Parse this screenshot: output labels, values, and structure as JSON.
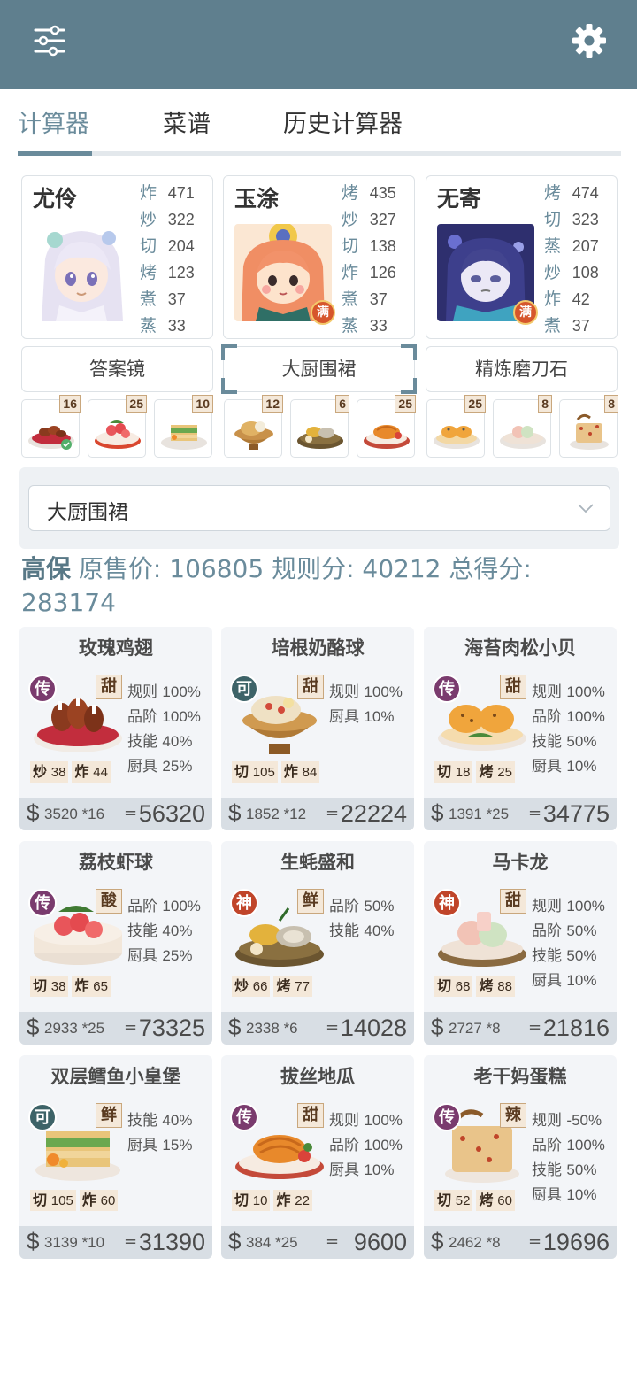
{
  "header": {
    "menu_icon": "sliders-icon",
    "settings_icon": "gear-icon",
    "bar_color": "#5f7f8e"
  },
  "tabs": [
    {
      "label": "计算器",
      "active": true
    },
    {
      "label": "菜谱",
      "active": false
    },
    {
      "label": "历史计算器",
      "active": false
    }
  ],
  "chefs": [
    {
      "name": "尤伶",
      "full": false,
      "skills": [
        {
          "k": "炸",
          "v": "471"
        },
        {
          "k": "炒",
          "v": "322"
        },
        {
          "k": "切",
          "v": "204"
        },
        {
          "k": "烤",
          "v": "123"
        },
        {
          "k": "煮",
          "v": "37"
        },
        {
          "k": "蒸",
          "v": "33"
        }
      ]
    },
    {
      "name": "玉涂",
      "full": true,
      "full_label": "满",
      "skills": [
        {
          "k": "烤",
          "v": "435"
        },
        {
          "k": "炒",
          "v": "327"
        },
        {
          "k": "切",
          "v": "138"
        },
        {
          "k": "炸",
          "v": "126"
        },
        {
          "k": "煮",
          "v": "37"
        },
        {
          "k": "蒸",
          "v": "33"
        }
      ]
    },
    {
      "name": "无寄",
      "full": true,
      "full_label": "满",
      "skills": [
        {
          "k": "烤",
          "v": "474"
        },
        {
          "k": "切",
          "v": "323"
        },
        {
          "k": "蒸",
          "v": "207"
        },
        {
          "k": "炒",
          "v": "108"
        },
        {
          "k": "炸",
          "v": "42"
        },
        {
          "k": "煮",
          "v": "37"
        }
      ]
    }
  ],
  "equipment_buttons": [
    {
      "label": "答案镜",
      "selected": false
    },
    {
      "label": "大厨围裙",
      "selected": true
    },
    {
      "label": "精炼磨刀石",
      "selected": false
    }
  ],
  "mini_dishes": [
    {
      "count": "16"
    },
    {
      "count": "25"
    },
    {
      "count": "10"
    },
    {
      "count": "12"
    },
    {
      "count": "6"
    },
    {
      "count": "25"
    },
    {
      "count": "25"
    },
    {
      "count": "8"
    },
    {
      "count": "8"
    }
  ],
  "equip_select": {
    "value": "大厨围裙"
  },
  "summary": {
    "grade": "高保",
    "orig_label": "原售价:",
    "orig_value": "106805",
    "rule_label": "规则分:",
    "rule_value": "40212",
    "total_label": "总得分:",
    "total_value": "283174"
  },
  "dishes": [
    {
      "name": "玫瑰鸡翅",
      "rarity": "传",
      "rarity_color": "#7a3b6e",
      "flavor": "甜",
      "bonus": [
        {
          "k": "规则",
          "v": "100%"
        },
        {
          "k": "品阶",
          "v": "100%"
        },
        {
          "k": "技能",
          "v": "40%"
        },
        {
          "k": "厨具",
          "v": "25%"
        }
      ],
      "req": [
        {
          "k": "炒",
          "v": "38"
        },
        {
          "k": "炸",
          "v": "44"
        }
      ],
      "price": "3520",
      "qty": "*16",
      "total": "56320"
    },
    {
      "name": "培根奶酪球",
      "rarity": "可",
      "rarity_color": "#3d6368",
      "flavor": "甜",
      "bonus": [
        {
          "k": "规则",
          "v": "100%"
        },
        {
          "k": "厨具",
          "v": "10%"
        }
      ],
      "req": [
        {
          "k": "切",
          "v": "105"
        },
        {
          "k": "炸",
          "v": "84"
        }
      ],
      "price": "1852",
      "qty": "*12",
      "total": "22224"
    },
    {
      "name": "海苔肉松小贝",
      "rarity": "传",
      "rarity_color": "#7a3b6e",
      "flavor": "甜",
      "bonus": [
        {
          "k": "规则",
          "v": "100%"
        },
        {
          "k": "品阶",
          "v": "100%"
        },
        {
          "k": "技能",
          "v": "50%"
        },
        {
          "k": "厨具",
          "v": "10%"
        }
      ],
      "req": [
        {
          "k": "切",
          "v": "18"
        },
        {
          "k": "烤",
          "v": "25"
        }
      ],
      "price": "1391",
      "qty": "*25",
      "total": "34775"
    },
    {
      "name": "荔枝虾球",
      "rarity": "传",
      "rarity_color": "#7a3b6e",
      "flavor": "酸",
      "bonus": [
        {
          "k": "品阶",
          "v": "100%"
        },
        {
          "k": "技能",
          "v": "40%"
        },
        {
          "k": "厨具",
          "v": "25%"
        }
      ],
      "req": [
        {
          "k": "切",
          "v": "38"
        },
        {
          "k": "炸",
          "v": "65"
        }
      ],
      "price": "2933",
      "qty": "*25",
      "total": "73325"
    },
    {
      "name": "生蚝盛和",
      "rarity": "神",
      "rarity_color": "#c0452a",
      "flavor": "鲜",
      "bonus": [
        {
          "k": "品阶",
          "v": "50%"
        },
        {
          "k": "技能",
          "v": "40%"
        }
      ],
      "req": [
        {
          "k": "炒",
          "v": "66"
        },
        {
          "k": "烤",
          "v": "77"
        }
      ],
      "price": "2338",
      "qty": "*6",
      "total": "14028"
    },
    {
      "name": "马卡龙",
      "rarity": "神",
      "rarity_color": "#c0452a",
      "flavor": "甜",
      "bonus": [
        {
          "k": "规则",
          "v": "100%"
        },
        {
          "k": "品阶",
          "v": "50%"
        },
        {
          "k": "技能",
          "v": "50%"
        },
        {
          "k": "厨具",
          "v": "10%"
        }
      ],
      "req": [
        {
          "k": "切",
          "v": "68"
        },
        {
          "k": "烤",
          "v": "88"
        }
      ],
      "price": "2727",
      "qty": "*8",
      "total": "21816"
    },
    {
      "name": "双层鳕鱼小皇堡",
      "rarity": "可",
      "rarity_color": "#3d6368",
      "flavor": "鲜",
      "bonus": [
        {
          "k": "技能",
          "v": "40%"
        },
        {
          "k": "厨具",
          "v": "15%"
        }
      ],
      "req": [
        {
          "k": "切",
          "v": "105"
        },
        {
          "k": "炸",
          "v": "60"
        }
      ],
      "price": "3139",
      "qty": "*10",
      "total": "31390"
    },
    {
      "name": "拔丝地瓜",
      "rarity": "传",
      "rarity_color": "#7a3b6e",
      "flavor": "甜",
      "bonus": [
        {
          "k": "规则",
          "v": "100%"
        },
        {
          "k": "品阶",
          "v": "100%"
        },
        {
          "k": "厨具",
          "v": "10%"
        }
      ],
      "req": [
        {
          "k": "切",
          "v": "10"
        },
        {
          "k": "炸",
          "v": "22"
        }
      ],
      "price": "384",
      "qty": "*25",
      "total": "9600"
    },
    {
      "name": "老干妈蛋糕",
      "rarity": "传",
      "rarity_color": "#7a3b6e",
      "flavor": "辣",
      "bonus": [
        {
          "k": "规则",
          "v": "-50%"
        },
        {
          "k": "品阶",
          "v": "100%"
        },
        {
          "k": "技能",
          "v": "50%"
        },
        {
          "k": "厨具",
          "v": "10%"
        }
      ],
      "req": [
        {
          "k": "切",
          "v": "52"
        },
        {
          "k": "烤",
          "v": "60"
        }
      ],
      "price": "2462",
      "qty": "*8",
      "total": "19696"
    }
  ],
  "currency_symbol": "$",
  "equals_symbol": "="
}
